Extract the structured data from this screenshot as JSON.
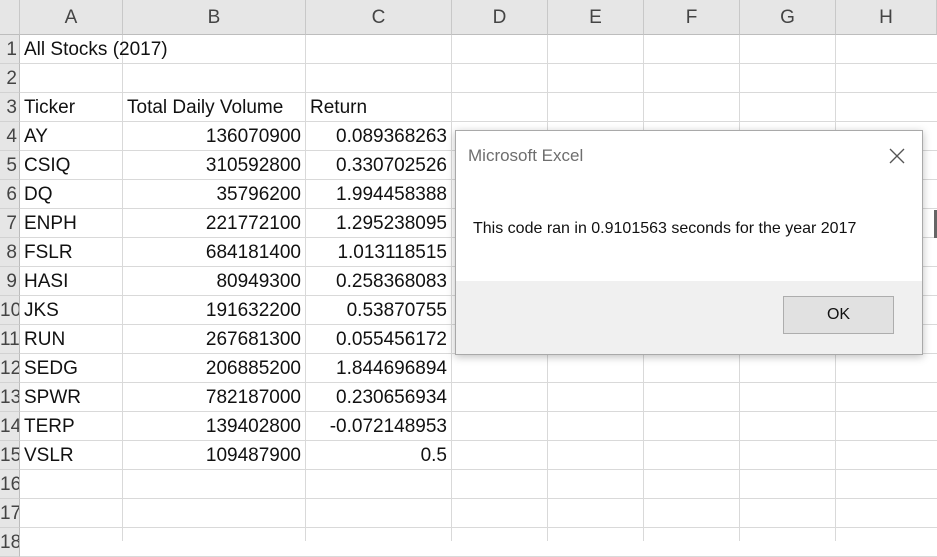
{
  "columns": [
    "A",
    "B",
    "C",
    "D",
    "E",
    "F",
    "G",
    "H"
  ],
  "rows": [
    "1",
    "2",
    "3",
    "4",
    "5",
    "6",
    "7",
    "8",
    "9",
    "10",
    "11",
    "12",
    "13",
    "14",
    "15",
    "16",
    "17",
    "18"
  ],
  "sheet": {
    "title": "All Stocks (2017)",
    "headers": {
      "ticker": "Ticker",
      "volume": "Total Daily Volume",
      "return": "Return"
    },
    "data": [
      {
        "ticker": "AY",
        "volume": "136070900",
        "return": "0.089368263"
      },
      {
        "ticker": "CSIQ",
        "volume": "310592800",
        "return": "0.330702526"
      },
      {
        "ticker": "DQ",
        "volume": "35796200",
        "return": "1.994458388"
      },
      {
        "ticker": "ENPH",
        "volume": "221772100",
        "return": "1.295238095"
      },
      {
        "ticker": "FSLR",
        "volume": "684181400",
        "return": "1.013118515"
      },
      {
        "ticker": "HASI",
        "volume": "80949300",
        "return": "0.258368083"
      },
      {
        "ticker": "JKS",
        "volume": "191632200",
        "return": "0.53870755"
      },
      {
        "ticker": "RUN",
        "volume": "267681300",
        "return": "0.055456172"
      },
      {
        "ticker": "SEDG",
        "volume": "206885200",
        "return": "1.844696894"
      },
      {
        "ticker": "SPWR",
        "volume": "782187000",
        "return": "0.230656934"
      },
      {
        "ticker": "TERP",
        "volume": "139402800",
        "return": "-0.072148953"
      },
      {
        "ticker": "VSLR",
        "volume": "109487900",
        "return": "0.5"
      }
    ]
  },
  "dialog": {
    "title": "Microsoft Excel",
    "message": "This code ran in 0.9101563 seconds for the year 2017",
    "ok_label": "OK",
    "close_icon": "close-icon"
  }
}
